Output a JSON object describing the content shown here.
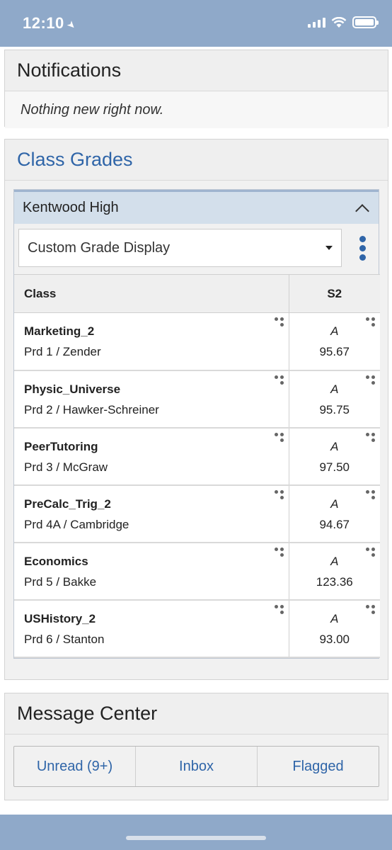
{
  "status_bar": {
    "time": "12:10"
  },
  "notifications": {
    "title": "Notifications",
    "empty_text": "Nothing new right now."
  },
  "class_grades": {
    "title": "Class Grades",
    "school": "Kentwood High",
    "display_select": "Custom Grade Display",
    "columns": {
      "class": "Class",
      "term": "S2"
    },
    "rows": [
      {
        "name": "Marketing_2",
        "period": "Prd 1 / Zender",
        "letter": "A",
        "score": "95.67"
      },
      {
        "name": "Physic_Universe",
        "period": "Prd 2 / Hawker-Schreiner",
        "letter": "A",
        "score": "95.75"
      },
      {
        "name": "PeerTutoring",
        "period": "Prd 3 / McGraw",
        "letter": "A",
        "score": "97.50"
      },
      {
        "name": "PreCalc_Trig_2",
        "period": "Prd 4A / Cambridge",
        "letter": "A",
        "score": "94.67"
      },
      {
        "name": "Economics",
        "period": "Prd 5 / Bakke",
        "letter": "A",
        "score": "123.36"
      },
      {
        "name": "USHistory_2",
        "period": "Prd 6 / Stanton",
        "letter": "A",
        "score": "93.00"
      }
    ]
  },
  "message_center": {
    "title": "Message Center",
    "tabs": [
      "Unread (9+)",
      "Inbox",
      "Flagged"
    ]
  },
  "colors": {
    "accent": "#2f65a8",
    "status_bar_bg": "#8fa9c9",
    "accordion_header_bg": "#d3dfeb"
  },
  "icons": {
    "location": "location-arrow-icon",
    "signal": "cellular-signal-icon",
    "wifi": "wifi-icon",
    "battery": "battery-icon",
    "collapse": "chevron-up-icon",
    "dropdown": "caret-down-icon",
    "more": "vertical-dots-icon",
    "cell_options": "three-dots-icon"
  }
}
